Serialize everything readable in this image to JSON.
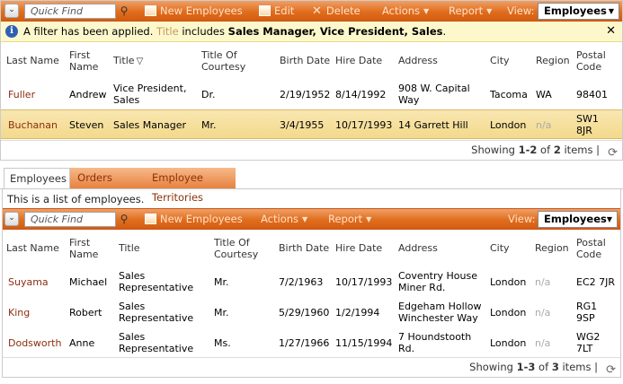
{
  "top": {
    "toolbar": {
      "quick_find_placeholder": "Quick Find",
      "new_label": "New Employees",
      "edit_label": "Edit",
      "delete_label": "Delete",
      "actions_label": "Actions",
      "report_label": "Report",
      "view_label": "View:",
      "view_value": "Employees"
    },
    "filter": {
      "prefix": "A filter has been applied.",
      "field": "Title",
      "verb": "includes",
      "values": "Sales Manager, Vice President, Sales",
      "suffix": ".",
      "close": "✕"
    },
    "columns": {
      "last_name": "Last Name",
      "first_name_1": "First",
      "first_name_2": "Name",
      "title": "Title",
      "toc_1": "Title Of",
      "toc_2": "Courtesy",
      "birth": "Birth Date",
      "hire": "Hire Date",
      "address": "Address",
      "city": "City",
      "region": "Region",
      "postal_1": "Postal",
      "postal_2": "Code"
    },
    "rows": [
      {
        "last": "Fuller",
        "first": "Andrew",
        "title1": "Vice President,",
        "title2": "Sales",
        "toc": "Dr.",
        "birth": "2/19/1952",
        "hire": "8/14/1992",
        "addr1": "908 W. Capital",
        "addr2": "Way",
        "city": "Tacoma",
        "region": "WA",
        "postal1": "98401",
        "postal2": ""
      },
      {
        "last": "Buchanan",
        "first": "Steven",
        "title1": "Sales Manager",
        "title2": "",
        "toc": "Mr.",
        "birth": "3/4/1955",
        "hire": "10/17/1993",
        "addr1": "14 Garrett Hill",
        "addr2": "",
        "city": "London",
        "region": "n/a",
        "postal1": "SW1",
        "postal2": "8JR"
      }
    ],
    "status": {
      "prefix": "Showing ",
      "range": "1-2",
      "of": " of ",
      "count": "2",
      "suffix": " items",
      "sep": "|"
    }
  },
  "tabs": [
    "Employees",
    "Orders",
    "Employee Territories"
  ],
  "description": "This is a list of employees.",
  "bottom": {
    "toolbar": {
      "quick_find_placeholder": "Quick Find",
      "new_label": "New Employees",
      "actions_label": "Actions",
      "report_label": "Report",
      "view_label": "View:",
      "view_value": "Employees"
    },
    "rows": [
      {
        "last": "Suyama",
        "first": "Michael",
        "title1": "Sales",
        "title2": "Representative",
        "toc": "Mr.",
        "birth": "7/2/1963",
        "hire": "10/17/1993",
        "addr1": "Coventry House",
        "addr2": "Miner Rd.",
        "city": "London",
        "region": "n/a",
        "postal1": "EC2 7JR",
        "postal2": ""
      },
      {
        "last": "King",
        "first": "Robert",
        "title1": "Sales",
        "title2": "Representative",
        "toc": "Mr.",
        "birth": "5/29/1960",
        "hire": "1/2/1994",
        "addr1": "Edgeham Hollow",
        "addr2": "Winchester Way",
        "city": "London",
        "region": "n/a",
        "postal1": "RG1",
        "postal2": "9SP"
      },
      {
        "last": "Dodsworth",
        "first": "Anne",
        "title1": "Sales",
        "title2": "Representative",
        "toc": "Ms.",
        "birth": "1/27/1966",
        "hire": "11/15/1994",
        "addr1": "7 Houndstooth",
        "addr2": "Rd.",
        "city": "London",
        "region": "n/a",
        "postal1": "WG2",
        "postal2": "7LT"
      }
    ],
    "status": {
      "prefix": "Showing ",
      "range": "1-3",
      "of": " of ",
      "count": "3",
      "suffix": " items",
      "sep": "|"
    }
  },
  "colors": {
    "accent": "#e06e1e",
    "link": "#8b2d10",
    "highlight": "#f3d98b",
    "filter_bg": "#fdf8cc"
  },
  "icons": [
    "menu-chevron-icon",
    "search-icon",
    "new-record-icon",
    "edit-icon",
    "delete-icon",
    "info-icon",
    "filter-icon",
    "close-icon",
    "refresh-icon"
  ]
}
